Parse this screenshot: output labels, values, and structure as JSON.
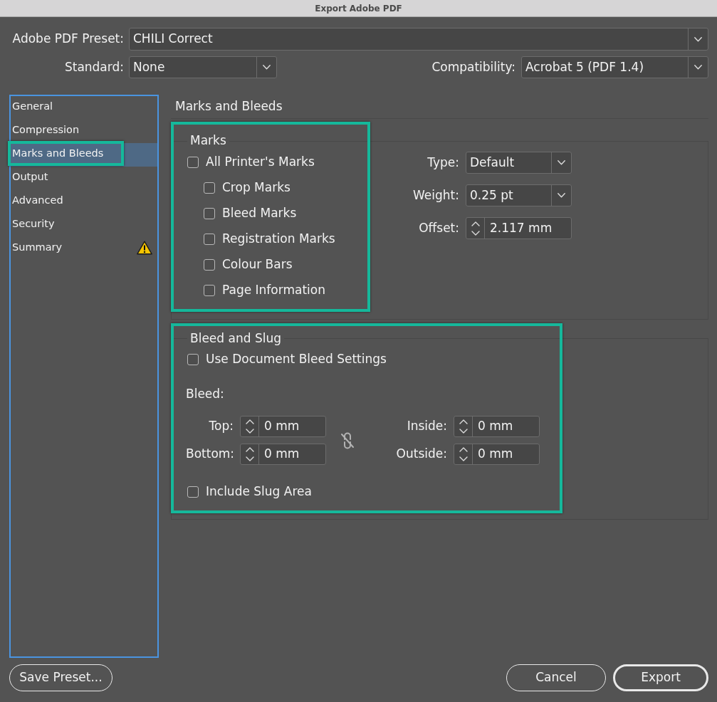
{
  "window": {
    "title": "Export Adobe PDF"
  },
  "preset": {
    "label": "Adobe PDF Preset:",
    "value": "CHILI Correct"
  },
  "standard": {
    "label": "Standard:",
    "value": "None"
  },
  "compatibility": {
    "label": "Compatibility:",
    "value": "Acrobat 5 (PDF 1.4)"
  },
  "sidebar": {
    "items": [
      {
        "label": "General",
        "selected": false,
        "highlighted": false,
        "warning": false
      },
      {
        "label": "Compression",
        "selected": false,
        "highlighted": false,
        "warning": false
      },
      {
        "label": "Marks and Bleeds",
        "selected": true,
        "highlighted": true,
        "warning": false
      },
      {
        "label": "Output",
        "selected": false,
        "highlighted": false,
        "warning": false
      },
      {
        "label": "Advanced",
        "selected": false,
        "highlighted": false,
        "warning": false
      },
      {
        "label": "Security",
        "selected": false,
        "highlighted": false,
        "warning": false
      },
      {
        "label": "Summary",
        "selected": false,
        "highlighted": false,
        "warning": true
      }
    ]
  },
  "panel": {
    "title": "Marks and Bleeds",
    "marks": {
      "title": "Marks",
      "highlighted": true,
      "options": [
        {
          "label": "All Printer's Marks",
          "checked": false,
          "children": [
            {
              "label": "Crop Marks",
              "checked": false
            },
            {
              "label": "Bleed Marks",
              "checked": false
            },
            {
              "label": "Registration Marks",
              "checked": false
            },
            {
              "label": "Colour Bars",
              "checked": false
            },
            {
              "label": "Page Information",
              "checked": false
            }
          ]
        }
      ],
      "settings": [
        {
          "kind": "dropdown",
          "label": "Type:",
          "value": "Default"
        },
        {
          "kind": "dropdown",
          "label": "Weight:",
          "value": "0.25 pt"
        },
        {
          "kind": "stepper",
          "label": "Offset:",
          "value": "2.117 mm"
        }
      ]
    },
    "bleed_and_slug": {
      "title": "Bleed and Slug",
      "highlighted": true,
      "use_document_bleed": {
        "label": "Use Document Bleed Settings",
        "checked": false
      },
      "bleed_label": "Bleed:",
      "fields": [
        {
          "label": "Top:",
          "value": "0 mm"
        },
        {
          "label": "Inside:",
          "value": "0 mm"
        },
        {
          "label": "Bottom:",
          "value": "0 mm"
        },
        {
          "label": "Outside:",
          "value": "0 mm"
        }
      ],
      "linked": false,
      "include_slug_area": {
        "label": "Include Slug Area",
        "checked": false
      }
    }
  },
  "footer": {
    "save_preset": {
      "label": "Save Preset..."
    },
    "buttons": [
      {
        "label": "Cancel",
        "default": false
      },
      {
        "label": "Export",
        "default": true
      }
    ]
  }
}
